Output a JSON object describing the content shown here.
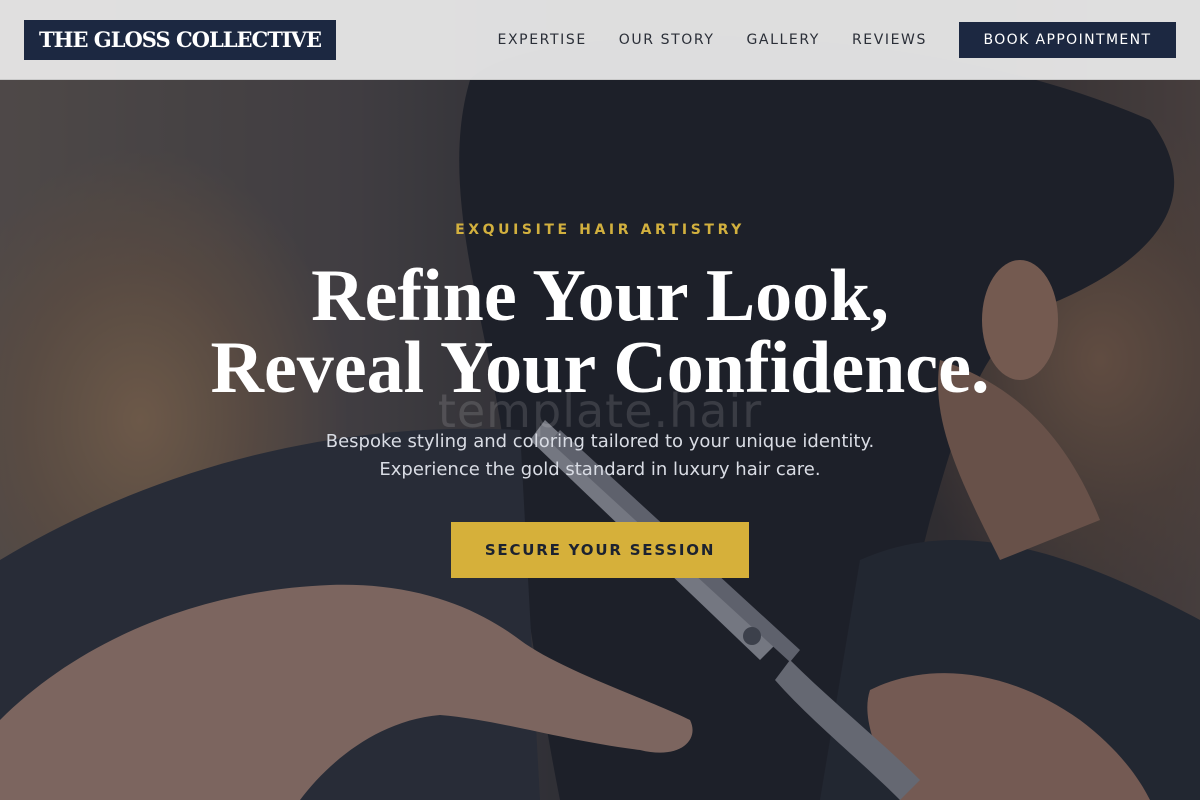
{
  "header": {
    "logo_text": "THE GLOSS COLLECTIVE",
    "nav": [
      {
        "label": "EXPERTISE"
      },
      {
        "label": "OUR STORY"
      },
      {
        "label": "GALLERY"
      },
      {
        "label": "REVIEWS"
      }
    ],
    "book_button": "BOOK APPOINTMENT"
  },
  "hero": {
    "eyebrow": "EXQUISITE HAIR ARTISTRY",
    "headline_line1": "Refine Your Look,",
    "headline_line2": "Reveal Your Confidence.",
    "watermark": "template.hair",
    "subtext_line1": "Bespoke styling and coloring tailored to your unique identity.",
    "subtext_line2": "Experience the gold standard in luxury hair care.",
    "cta_label": "SECURE YOUR SESSION"
  },
  "colors": {
    "navy": "#1c2841",
    "gold": "#d6b03a",
    "eyebrow_gold": "#d2b03e",
    "header_bg": "#e8e8e8"
  },
  "background_image": "salon-haircut-photo"
}
